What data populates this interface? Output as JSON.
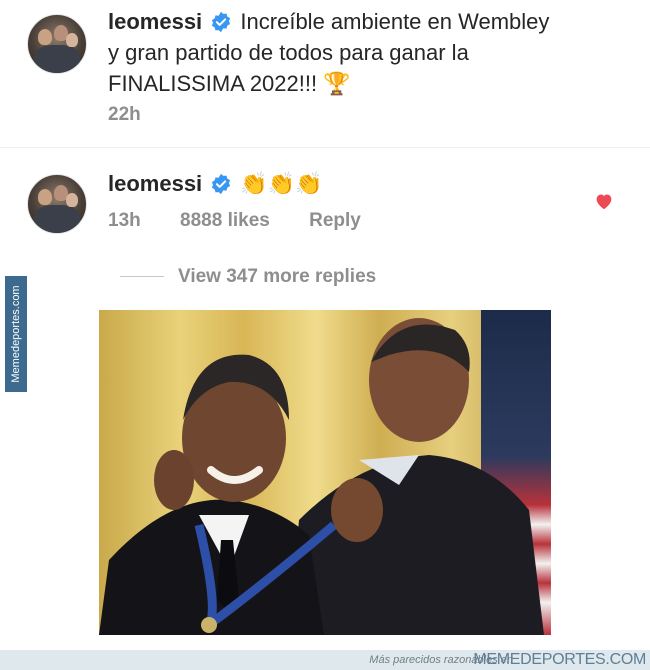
{
  "post": {
    "username": "leomessi",
    "caption_line1": "Increíble ambiente en Wembley",
    "caption_line2": "y gran partido de todos para ganar la",
    "caption_line3": "FINALISSIMA 2022!!! 🏆",
    "time": "22h"
  },
  "reply": {
    "username": "leomessi",
    "text": "👏👏👏",
    "time": "13h",
    "likes": "8888 likes",
    "reply_label": "Reply",
    "liked": true
  },
  "view_more": "View 347 more replies",
  "meme": {
    "description_icon": "medal-ceremony-photo"
  },
  "watermark": {
    "side_text": "Memedeportes.com",
    "bottom_text": "Más parecidos razonables en",
    "brand": "MEMEDEPORTES.COM"
  },
  "colors": {
    "verified": "#3897f0",
    "heart": "#ed4956",
    "muted": "#8e8e8e"
  }
}
